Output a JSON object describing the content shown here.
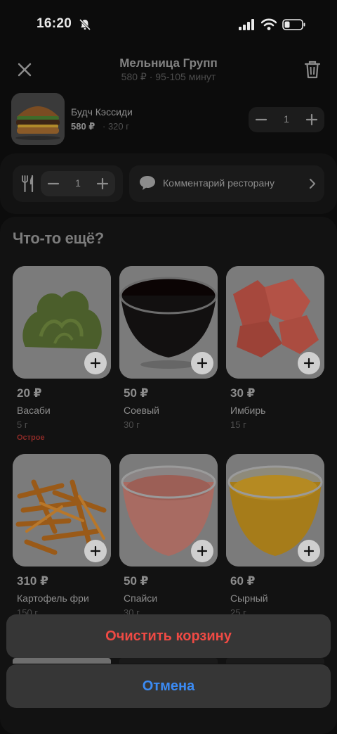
{
  "status_bar": {
    "time": "16:20"
  },
  "header": {
    "restaurant_name": "Мельница Групп",
    "subtitle": "580 ₽ · 95-105 минут"
  },
  "cart_item": {
    "name": "Будч Кэссиди",
    "price": "580 ₽",
    "weight": "· 320 г",
    "quantity": "1"
  },
  "extras": {
    "cutlery_quantity": "1",
    "comment_label": "Комментарий ресторану"
  },
  "upsell": {
    "title": "Что-то ещё?",
    "items": [
      {
        "price": "20 ₽",
        "name": "Васаби",
        "weight": "5 г",
        "tag": "Острое"
      },
      {
        "price": "50 ₽",
        "name": "Соевый",
        "weight": "30 г",
        "tag": ""
      },
      {
        "price": "30 ₽",
        "name": "Имбирь",
        "weight": "15 г",
        "tag": ""
      },
      {
        "price": "310 ₽",
        "name": "Картофель фри",
        "weight": "150 г",
        "tag": ""
      },
      {
        "price": "50 ₽",
        "name": "Спайси",
        "weight": "30 г",
        "tag": ""
      },
      {
        "price": "60 ₽",
        "name": "Сырный",
        "weight": "25 г",
        "tag": ""
      }
    ]
  },
  "action_sheet": {
    "clear_label": "Очистить корзину",
    "cancel_label": "Отмена"
  },
  "colors": {
    "destructive": "#ef4a44",
    "accent": "#3b8bf4",
    "spicy": "#8b2a27"
  }
}
